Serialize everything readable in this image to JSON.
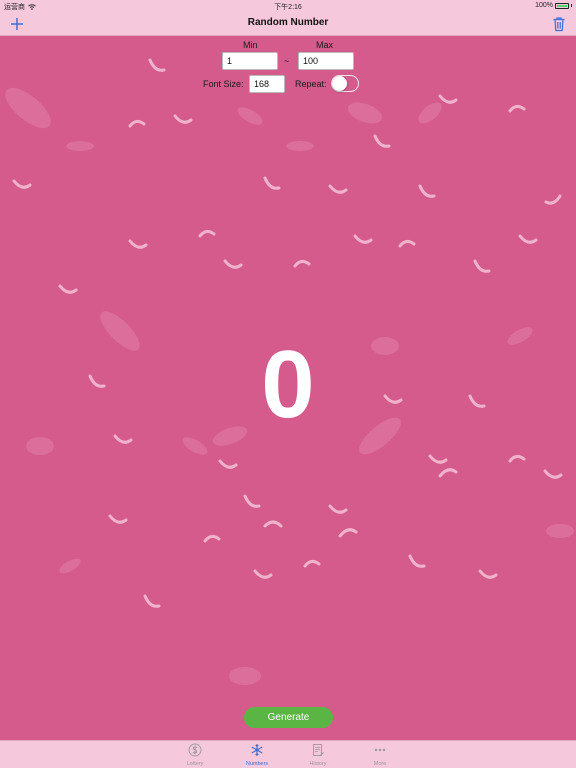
{
  "status_bar": {
    "carrier": "运营商",
    "time": "下午2:16",
    "battery": "100%"
  },
  "nav": {
    "title": "Random Number"
  },
  "controls": {
    "min_label": "Min",
    "max_label": "Max",
    "min_value": "1",
    "range_separator": "~",
    "max_value": "100",
    "font_size_label": "Font Size:",
    "font_size_value": "168",
    "repeat_label": "Repeat:",
    "repeat_on": false
  },
  "result": "0",
  "generate_label": "Generate",
  "tabs": [
    {
      "label": "Lottery",
      "icon": "dollar-coin-icon",
      "active": false
    },
    {
      "label": "Numbers",
      "icon": "snowflake-icon",
      "active": true
    },
    {
      "label": "History",
      "icon": "history-doc-icon",
      "active": false
    },
    {
      "label": "More",
      "icon": "more-dots-icon",
      "active": false
    }
  ],
  "colors": {
    "background": "#d45b8c",
    "bars": "#f5c8dc",
    "accent": "#3a6fd8",
    "generate": "#5ab545"
  }
}
